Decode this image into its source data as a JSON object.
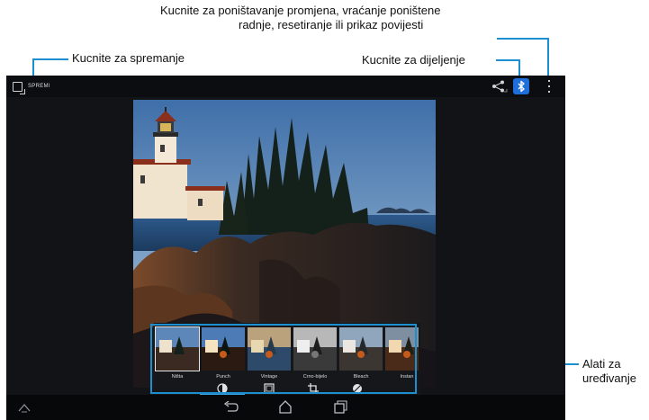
{
  "callouts": {
    "undo": [
      "Kucnite za poništavanje promjena, vraćanje poništene",
      "radnje, resetiranje ili prikaz povijesti"
    ],
    "save": "Kucnite za spremanje",
    "share": "Kucnite za dijeljenje",
    "tools": [
      "Alati za",
      "uređivanje"
    ]
  },
  "actionbar": {
    "save_label": "SPREMI",
    "save_icon": "save-icon",
    "share_icon": "share-icon",
    "bluetooth_icon": "bluetooth-icon",
    "overflow_icon": "overflow-menu-icon"
  },
  "filters": [
    {
      "label": "Ništa",
      "tint": "none"
    },
    {
      "label": "Punch",
      "tint": "#7a3a10"
    },
    {
      "label": "Vintage",
      "tint": "#2b4f7a"
    },
    {
      "label": "Crno-bijelo",
      "tint": "#888888"
    },
    {
      "label": "Bleach",
      "tint": "#9aa3ad"
    },
    {
      "label": "Instan",
      "tint": "#b07a2a"
    }
  ],
  "tool_tabs": [
    {
      "name": "tab-filters",
      "icon": "filters-icon",
      "selected": true
    },
    {
      "name": "tab-frames",
      "icon": "frame-icon",
      "selected": false
    },
    {
      "name": "tab-crop",
      "icon": "crop-icon",
      "selected": false
    },
    {
      "name": "tab-adjust",
      "icon": "exposure-icon",
      "selected": false
    }
  ],
  "navbar": [
    "home-up-icon",
    "back-icon",
    "home-icon",
    "recent-apps-icon"
  ],
  "colors": {
    "accent": "#1b8fd0",
    "screen_bg": "#111317",
    "bluetooth": "#1e6fd9"
  }
}
